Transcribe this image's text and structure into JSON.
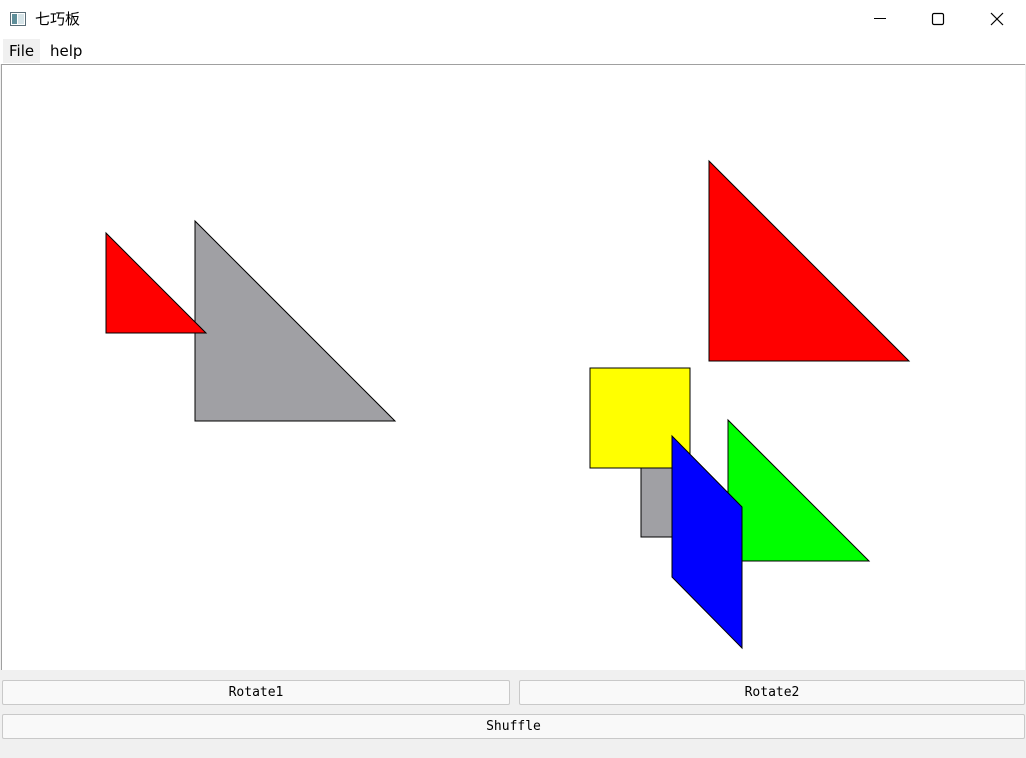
{
  "window": {
    "title": "七巧板"
  },
  "menu": {
    "items": [
      {
        "label": "File"
      },
      {
        "label": "help"
      }
    ]
  },
  "buttons": {
    "rotate1": "Rotate1",
    "rotate2": "Rotate2",
    "shuffle": "Shuffle"
  },
  "pieces": [
    {
      "name": "small-red-triangle",
      "color": "#ff0000"
    },
    {
      "name": "large-gray-triangle",
      "color": "#a0a0a4"
    },
    {
      "name": "large-red-triangle",
      "color": "#ff0000"
    },
    {
      "name": "yellow-square",
      "color": "#ffff00"
    },
    {
      "name": "gray-small-piece",
      "color": "#a0a0a4"
    },
    {
      "name": "green-triangle",
      "color": "#00ff00"
    },
    {
      "name": "blue-parallelogram",
      "color": "#0000ff"
    }
  ]
}
